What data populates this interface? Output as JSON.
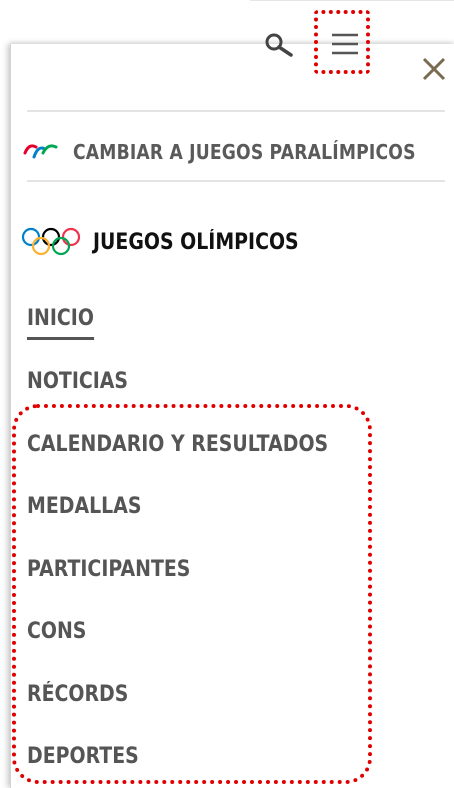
{
  "header": {
    "search_icon": "search-icon",
    "menu_icon": "hamburger-menu-icon"
  },
  "panel": {
    "close_icon": "close-icon",
    "switch_link": {
      "icon": "paralympic-agitos-icon",
      "label": "CAMBIAR A JUEGOS PARALÍMPICOS"
    },
    "section_title": {
      "icon": "olympic-rings-icon",
      "label": "JUEGOS OLÍMPICOS"
    },
    "nav_items": [
      {
        "label": "INICIO",
        "active": true
      },
      {
        "label": "NOTICIAS",
        "active": false
      },
      {
        "label": "CALENDARIO Y RESULTADOS",
        "active": false
      },
      {
        "label": "MEDALLAS",
        "active": false
      },
      {
        "label": "PARTICIPANTES",
        "active": false
      },
      {
        "label": "CONS",
        "active": false
      },
      {
        "label": "RÉCORDS",
        "active": false
      },
      {
        "label": "DEPORTES",
        "active": false
      }
    ]
  },
  "colors": {
    "highlight": "#e00000",
    "close_icon": "#7a6a4f",
    "nav_text": "#555555",
    "title_text": "#111111",
    "rings": [
      "#0081c8",
      "#fcb131",
      "#000000",
      "#00a651",
      "#ee334e"
    ],
    "agitos": [
      "#e4002b",
      "#0081c8",
      "#00a651"
    ]
  }
}
